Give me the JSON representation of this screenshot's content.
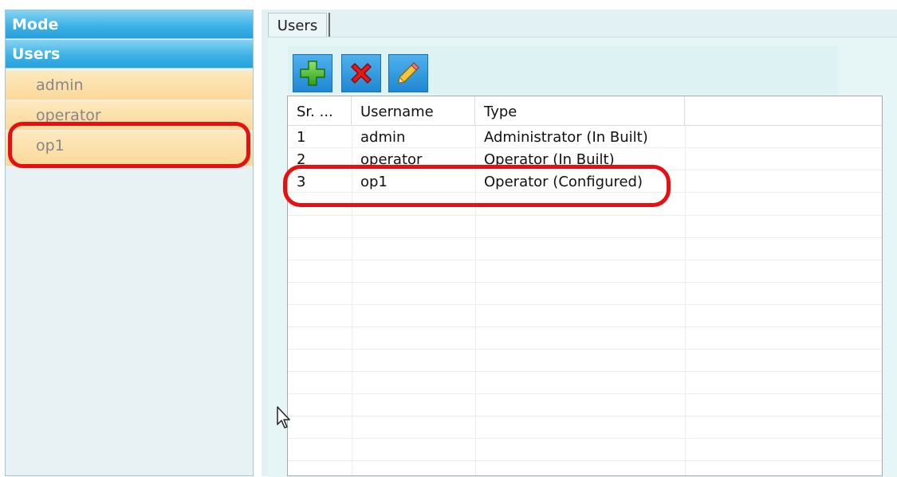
{
  "sidebar": {
    "mode_label": "Mode",
    "users_label": "Users",
    "items": [
      {
        "label": "admin"
      },
      {
        "label": "operator"
      },
      {
        "label": "op1"
      }
    ]
  },
  "tabs": [
    {
      "label": "Users"
    }
  ],
  "toolbar": {
    "add_icon": "add-user-icon",
    "delete_icon": "delete-user-icon",
    "edit_icon": "edit-user-icon"
  },
  "grid": {
    "headers": [
      "Sr. ...",
      "Username",
      "Type"
    ],
    "rows": [
      {
        "sr": "1",
        "username": "admin",
        "type": "Administrator (In Built)"
      },
      {
        "sr": "2",
        "username": "operator",
        "type": "Operator (In Built)"
      },
      {
        "sr": "3",
        "username": "op1",
        "type": "Operator (Configured)"
      }
    ]
  },
  "colors": {
    "highlight": "#e60f12",
    "header_blue": "#26a0db",
    "item_orange": "#fbd99a"
  }
}
